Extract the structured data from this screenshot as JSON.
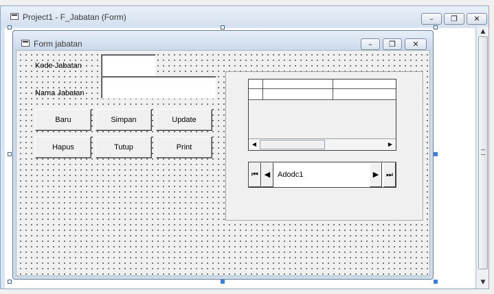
{
  "outer_window": {
    "title": "Project1 - F_Jabatan (Form)",
    "controls": {
      "minimize": "–",
      "restore": "❐",
      "close": "✕"
    }
  },
  "form": {
    "title": "Form jabatan",
    "controls": {
      "minimize": "–",
      "restore": "❐",
      "close": "✕"
    },
    "labels": {
      "kode": "Kode Jabatan",
      "nama": "Nama Jabatan"
    },
    "inputs": {
      "kode_value": "",
      "nama_value": ""
    },
    "buttons": {
      "baru": "Baru",
      "simpan": "Simpan",
      "update": "Update",
      "hapus": "Hapus",
      "tutup": "Tutup",
      "print": "Print"
    },
    "adodc": {
      "caption": "Adodc1",
      "first": "⏮",
      "prev": "◀",
      "next": "▶",
      "last": "⏭"
    },
    "grid": {
      "scroll_left": "◀",
      "scroll_right": "▶"
    }
  },
  "scrollbar": {
    "up": "▲",
    "down": "▼"
  },
  "icons": [
    "form-window-icon",
    "close-icon",
    "minimize-icon",
    "restore-icon"
  ]
}
